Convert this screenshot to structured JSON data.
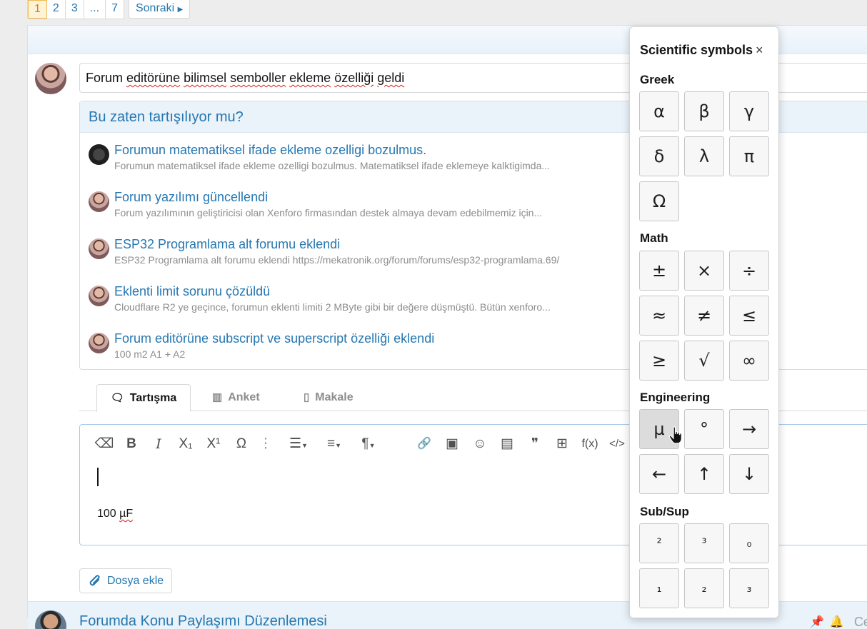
{
  "pagination": {
    "pages": [
      "1",
      "2",
      "3",
      "...",
      "7"
    ],
    "current": "1",
    "next_label": "Sonraki"
  },
  "thread_title": {
    "before": "Forum ",
    "word1": "editörüne",
    "mid1": " ",
    "word2": "bilimsel",
    "mid2": " ",
    "word3": "semboller",
    "mid3": " ",
    "word4": "ekleme",
    "mid4": " ",
    "word5": "özelliği",
    "mid5": " ",
    "word6": "geldi"
  },
  "similar": {
    "heading": "Bu zaten tartışılıyor mu?",
    "items": [
      {
        "title": "Forumun matematiksel ifade ekleme ozelligi bozulmus.",
        "snippet": "Forumun matematiksel ifade ekleme ozelligi bozulmus. Matematiksel ifade eklemeye kalktigimda..."
      },
      {
        "title": "Forum yazılımı güncellendi",
        "snippet": "Forum yazılımının geliştiricisi olan Xenforo firmasından destek almaya devam edebilmemiz için..."
      },
      {
        "title": "ESP32 Programlama alt forumu eklendi",
        "snippet": "ESP32 Programlama alt forumu eklendi https://mekatronik.org/forum/forums/esp32-programlama.69/"
      },
      {
        "title": "Eklenti limit sorunu çözüldü",
        "snippet": "Cloudflare R2 ye geçince, forumun eklenti limiti 2 MByte gibi bir değere düşmüştü. Bütün xenforo..."
      },
      {
        "title": "Forum editörüne subscript ve superscript özelliği eklendi",
        "snippet": "100 m2 A1 + A2"
      }
    ]
  },
  "tabs": [
    {
      "label": "Tartışma",
      "icon": "comments-icon"
    },
    {
      "label": "Anket",
      "icon": "bar-chart-icon"
    },
    {
      "label": "Makale",
      "icon": "document-icon"
    }
  ],
  "toolbar": {
    "eraser": "⌫",
    "bold": "B",
    "italic": "I",
    "subscript": "X₁",
    "superscript": "X¹",
    "omega": "Ω",
    "more": "⋮",
    "list": "☰",
    "align": "≡",
    "paragraph": "¶",
    "link": "🔗",
    "image": "▣",
    "emoji": "☺",
    "gallery": "▤",
    "quote": "❞",
    "table": "⊞",
    "formula": "f(x)",
    "code": "</>"
  },
  "editor": {
    "value": "100 ",
    "word": "µF"
  },
  "attach_label": "Dosya ekle",
  "next_thread": {
    "title": "Forumda Konu Paylaşımı Düzenlemesi",
    "trailing": "Ce"
  },
  "symbols": {
    "title": "Scientific symbols",
    "close": "×",
    "greek_label": "Greek",
    "greek": [
      "α",
      "β",
      "γ",
      "δ",
      "λ",
      "π",
      "Ω"
    ],
    "math_label": "Math",
    "math": [
      "±",
      "×",
      "÷",
      "≈",
      "≠",
      "≤",
      "≥",
      "√",
      "∞"
    ],
    "engineering_label": "Engineering",
    "engineering": [
      "µ",
      "°",
      "→",
      "←",
      "↑",
      "↓"
    ],
    "subsup_label_a": "Sub",
    "subsup_label_b": "/Sup",
    "subsup": [
      "²",
      "³",
      "₀",
      "₁",
      "₂",
      "₃"
    ]
  },
  "colors": {
    "link": "#2577b1",
    "current_page": "#e27c00",
    "header_bg": "#eaf2fa"
  }
}
